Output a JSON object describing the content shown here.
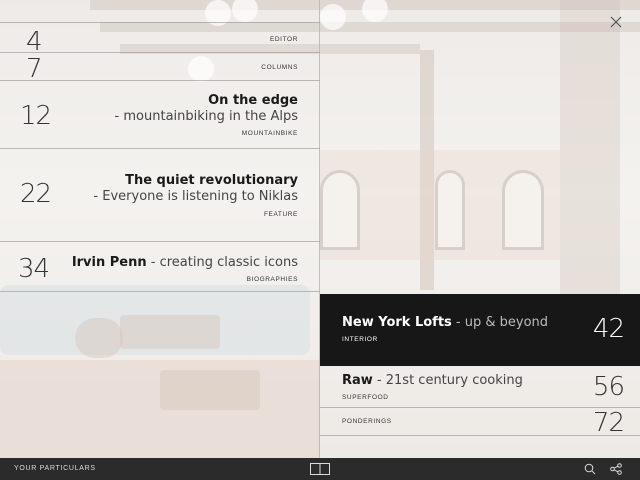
{
  "left_items": [
    {
      "page": "4",
      "category": "EDITOR"
    },
    {
      "page": "7",
      "category": "COLUMNS"
    },
    {
      "page": "12",
      "title": "On the edge",
      "subtitle": "- mountainbiking in the Alps",
      "category": "MOUNTAINBIKE"
    },
    {
      "page": "22",
      "title": "The quiet revolutionary",
      "subtitle": "- Everyone is listening to Niklas",
      "category": "FEATURE"
    },
    {
      "page": "34",
      "title": "Irvin Penn",
      "subtitle": " - creating classic icons",
      "category": "BIOGRAPHIES"
    }
  ],
  "right_items": [
    {
      "page": "42",
      "title": "New York Lofts",
      "subtitle": " - up & beyond",
      "category": "INTERIOR",
      "active": true
    },
    {
      "page": "56",
      "title": "Raw",
      "subtitle": " - 21st century cooking",
      "category": "SUPERFOOD"
    },
    {
      "page": "72",
      "category": "PONDERINGS"
    }
  ],
  "footer": {
    "label": "YOUR PARTICULARS"
  },
  "icons": {
    "close": "close-icon",
    "layout": "layout-icon",
    "search": "search-icon",
    "share": "share-icon"
  },
  "colors": {
    "active_bg": "#171717",
    "footer_bg": "#2b2b2b"
  }
}
